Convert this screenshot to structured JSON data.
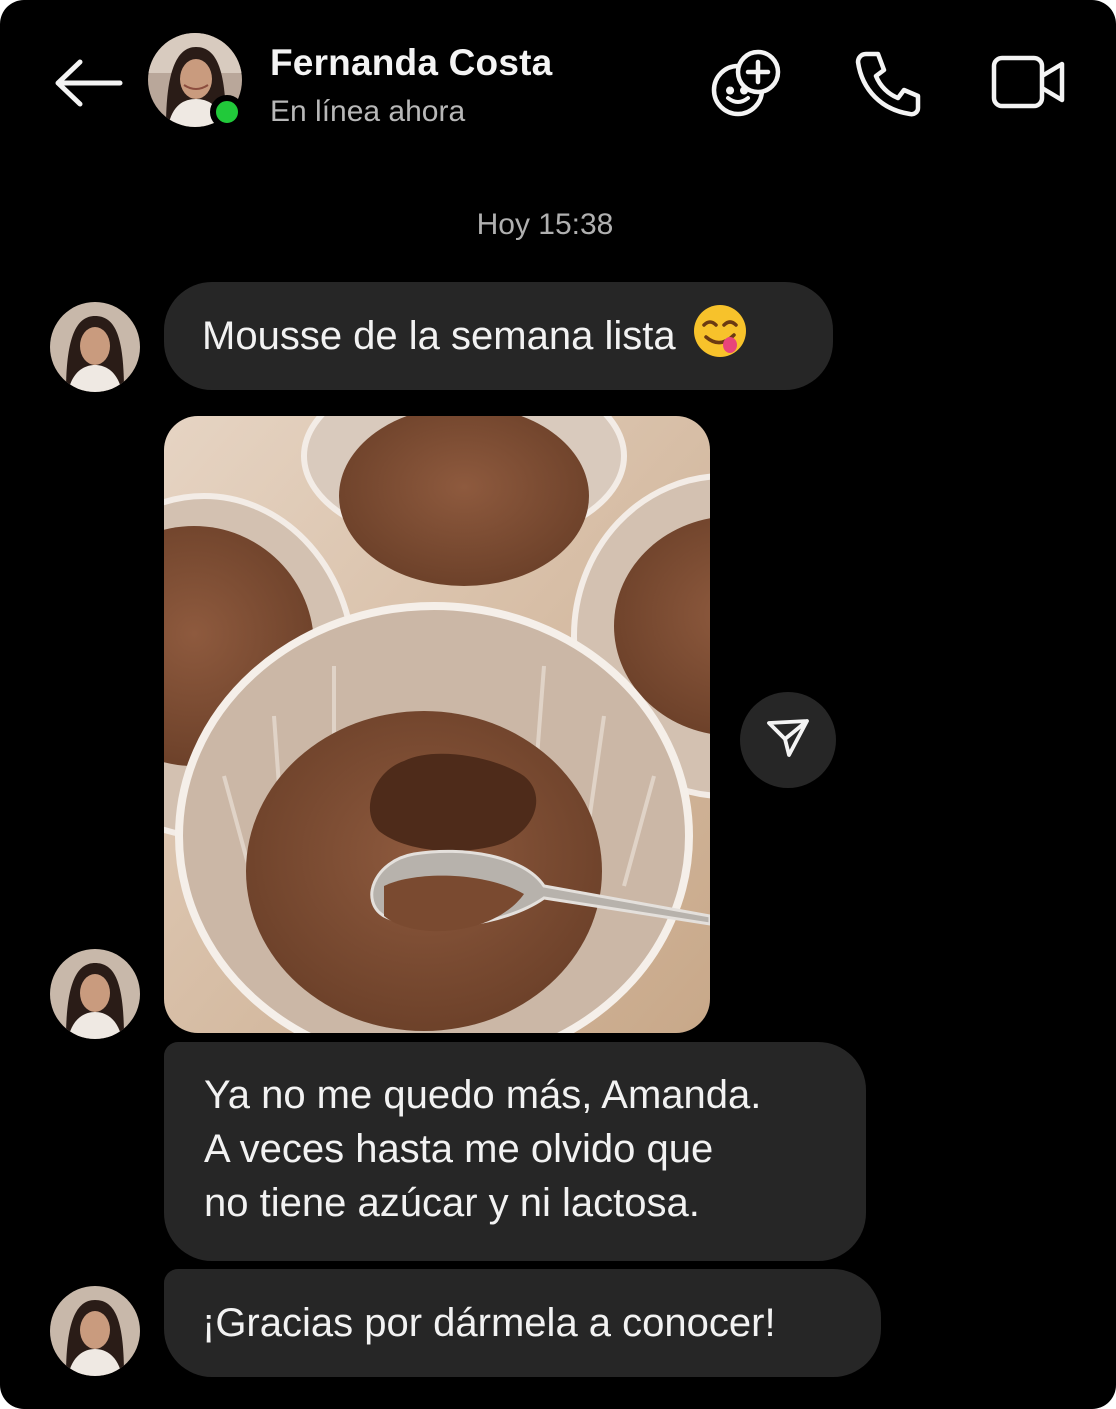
{
  "header": {
    "contact_name": "Fernanda Costa",
    "status": "En línea ahora",
    "online_color": "#21c93a",
    "icons": [
      "back-arrow-icon",
      "sticker-add-icon",
      "phone-icon",
      "video-camera-icon"
    ]
  },
  "conversation": {
    "timestamp": "Hoy 15:38",
    "messages": [
      {
        "type": "text",
        "text": "Mousse de la semana lista",
        "emoji": "😋"
      },
      {
        "type": "image",
        "description_icon": "photo"
      },
      {
        "type": "text",
        "lines": [
          "Ya no me quedo más, Amanda.",
          "A veces hasta me olvido que",
          "no tiene azúcar y ni lactosa."
        ]
      },
      {
        "type": "text",
        "text": "¡Gracias por dármela a conocer!"
      }
    ]
  },
  "colors": {
    "background": "#000000",
    "bubble": "#262626",
    "text": "#f2f2f2",
    "muted": "#b0b0b0"
  }
}
